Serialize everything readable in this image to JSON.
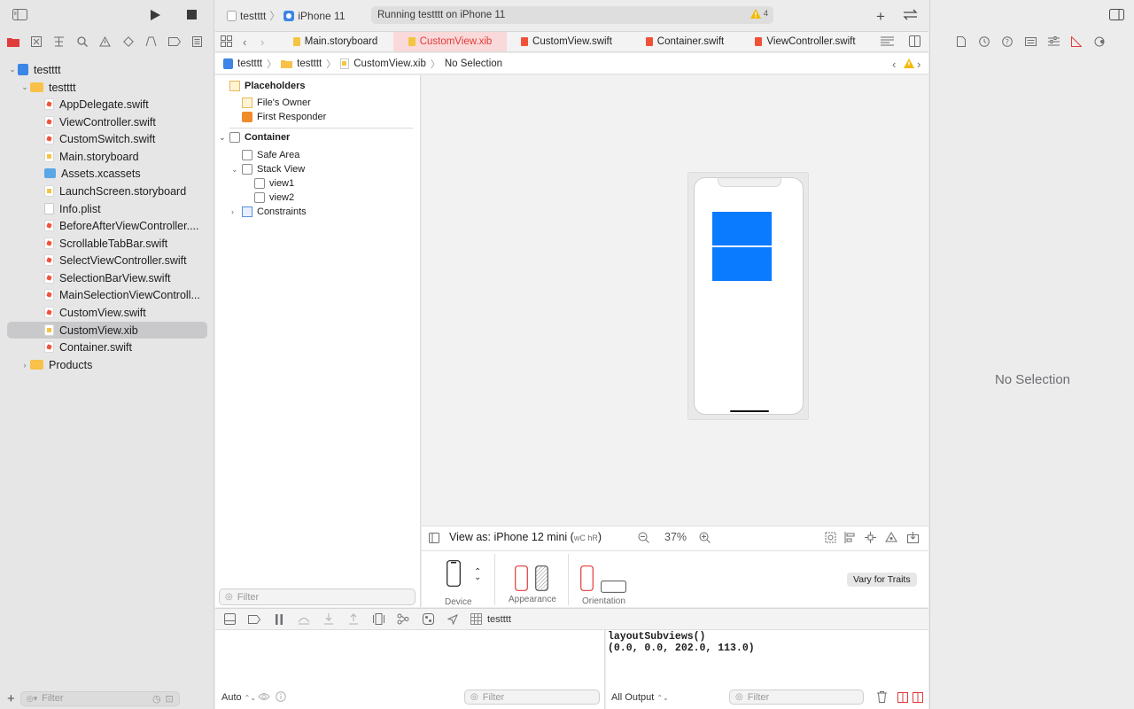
{
  "toolbar": {
    "scheme_project": "testttt",
    "scheme_device": "iPhone 11",
    "activity_status": "Running testttt on iPhone 11",
    "warning_count": "4"
  },
  "navigator": {
    "items": [
      {
        "label": "testttt",
        "type": "project",
        "depth": 0,
        "expanded": true
      },
      {
        "label": "testttt",
        "type": "folder",
        "depth": 1,
        "expanded": true
      },
      {
        "label": "AppDelegate.swift",
        "type": "swift",
        "depth": 2
      },
      {
        "label": "ViewController.swift",
        "type": "swift",
        "depth": 2
      },
      {
        "label": "CustomSwitch.swift",
        "type": "swift",
        "depth": 2
      },
      {
        "label": "Main.storyboard",
        "type": "storyboard",
        "depth": 2
      },
      {
        "label": "Assets.xcassets",
        "type": "assets",
        "depth": 2
      },
      {
        "label": "LaunchScreen.storyboard",
        "type": "storyboard",
        "depth": 2
      },
      {
        "label": "Info.plist",
        "type": "plist",
        "depth": 2
      },
      {
        "label": "BeforeAfterViewController....",
        "type": "swift",
        "depth": 2
      },
      {
        "label": "ScrollableTabBar.swift",
        "type": "swift",
        "depth": 2
      },
      {
        "label": "SelectViewController.swift",
        "type": "swift",
        "depth": 2
      },
      {
        "label": "SelectionBarView.swift",
        "type": "swift",
        "depth": 2
      },
      {
        "label": "MainSelectionViewControll...",
        "type": "swift",
        "depth": 2
      },
      {
        "label": "CustomView.swift",
        "type": "swift",
        "depth": 2
      },
      {
        "label": "CustomView.xib",
        "type": "storyboard",
        "depth": 2,
        "selected": true
      },
      {
        "label": "Container.swift",
        "type": "swift",
        "depth": 2
      },
      {
        "label": "Products",
        "type": "folder",
        "depth": 1,
        "expanded": false
      }
    ],
    "filter_placeholder": "Filter"
  },
  "tabs": [
    {
      "label": "Main.storyboard"
    },
    {
      "label": "CustomView.xib",
      "active": true
    },
    {
      "label": "CustomView.swift"
    },
    {
      "label": "Container.swift"
    },
    {
      "label": "ViewController.swift"
    }
  ],
  "jump_bar": {
    "crumbs": [
      "testttt",
      "testttt",
      "CustomView.xib",
      "No Selection"
    ]
  },
  "outline": {
    "placeholders_header": "Placeholders",
    "files_owner": "File's Owner",
    "first_responder": "First Responder",
    "container": "Container",
    "safe_area": "Safe Area",
    "stack_view": "Stack View",
    "view1": "view1",
    "view2": "view2",
    "constraints": "Constraints",
    "filter_placeholder": "Filter"
  },
  "canvas": {
    "view_as": "View as: iPhone 12 mini (",
    "size_class": "wC hR",
    "view_as_end": ")",
    "zoom": "37%"
  },
  "device_config": {
    "device_label": "Device",
    "appearance_label": "Appearance",
    "orientation_label": "Orientation",
    "vary_button": "Vary for Traits"
  },
  "debug": {
    "target": "testttt",
    "auto_label": "Auto",
    "filter_placeholder": "Filter",
    "output_select": "All Output",
    "console_lines": [
      "layoutSubviews()",
      "(0.0, 0.0, 202.0, 113.0)"
    ]
  },
  "inspector": {
    "empty_message": "No Selection"
  },
  "colors": {
    "accent": "#0A7AFF",
    "active_tab_bg": "#F9D9D9",
    "active_tab_text": "#E23B3B",
    "warning": "#F5B800"
  }
}
